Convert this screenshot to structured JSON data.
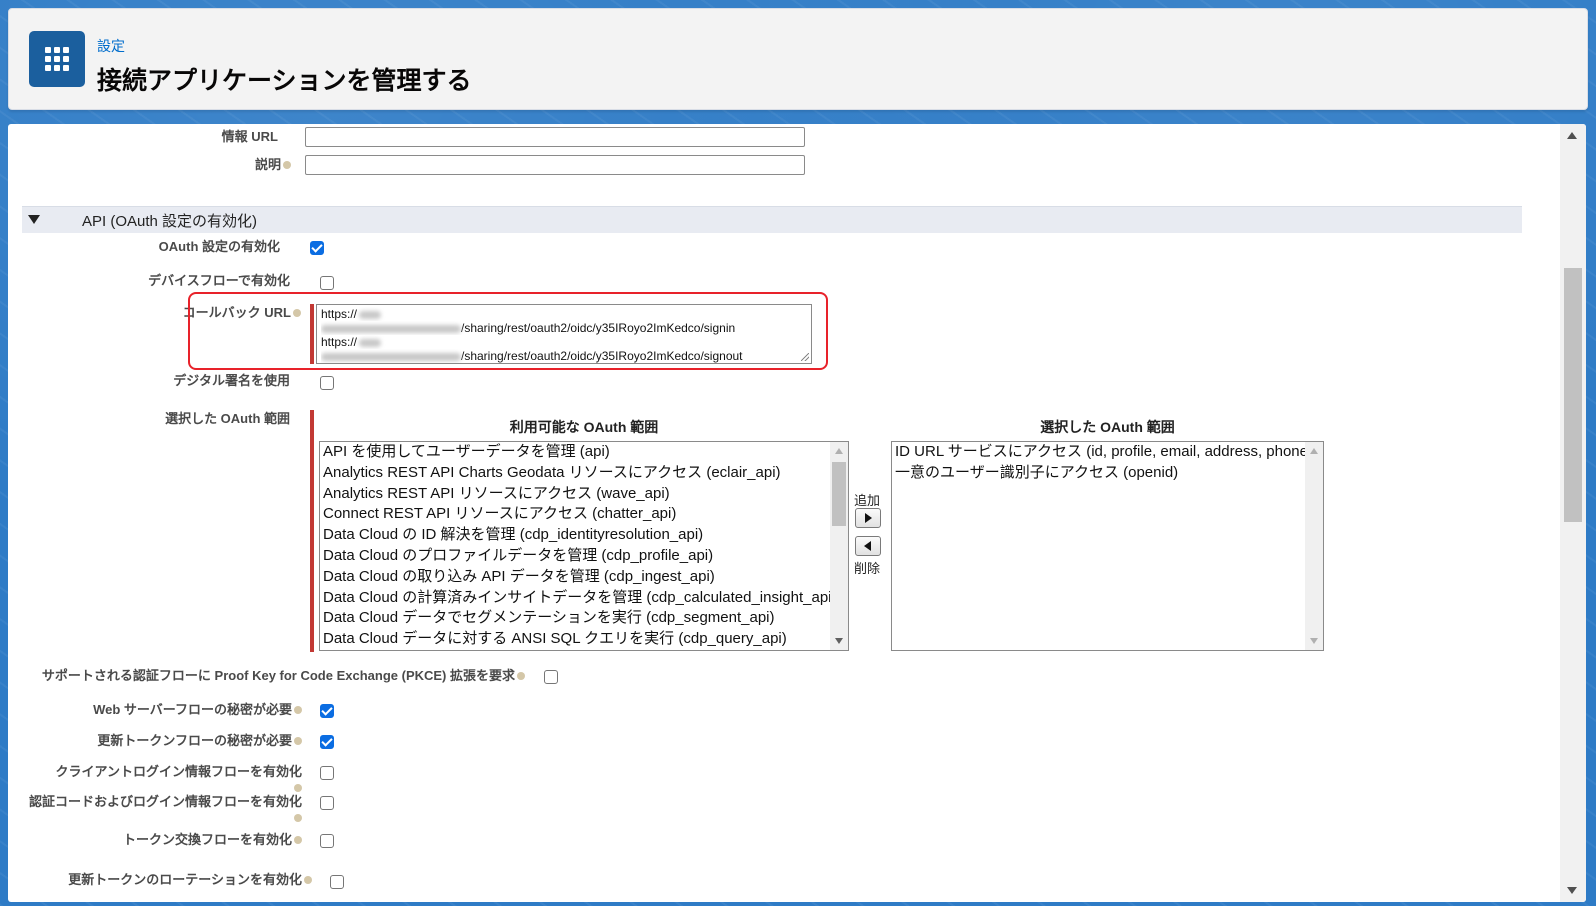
{
  "header": {
    "breadcrumb": "設定",
    "title": "接続アプリケーションを管理する",
    "icon": "app-launcher-grid-icon"
  },
  "fields": {
    "info_url_label": "情報 URL",
    "info_url_value": "",
    "description_label": "説明",
    "description_value": ""
  },
  "section": {
    "title": "API (OAuth 設定の有効化)"
  },
  "oauth": {
    "enable_label": "OAuth 設定の有効化",
    "enable_checked": true,
    "device_flow_label": "デバイスフローで有効化",
    "device_flow_checked": false,
    "callback_label": "コールバック URL",
    "callback_lines": [
      "https://",
      "/sharing/rest/oauth2/oidc/y35IRoyo2ImKedco/signin",
      "https://",
      "/sharing/rest/oauth2/oidc/y35IRoyo2ImKedco/signout"
    ],
    "digital_sig_label": "デジタル署名を使用",
    "digital_sig_checked": false,
    "scopes_label": "選択した OAuth 範囲",
    "available_header": "利用可能な OAuth 範囲",
    "selected_header": "選択した OAuth 範囲",
    "add_label": "追加",
    "remove_label": "削除",
    "available_scopes": [
      "API を使用してユーザーデータを管理 (api)",
      "Analytics REST API Charts Geodata リソースにアクセス (eclair_api)",
      "Analytics REST API リソースにアクセス (wave_api)",
      "Connect REST API リソースにアクセス (chatter_api)",
      "Data Cloud の ID 解決を管理 (cdp_identityresolution_api)",
      "Data Cloud のプロファイルデータを管理 (cdp_profile_api)",
      "Data Cloud の取り込み API データを管理 (cdp_ingest_api)",
      "Data Cloud の計算済みインサイトデータを管理 (cdp_calculated_insight_api)",
      "Data Cloud データでセグメンテーションを実行 (cdp_segment_api)",
      "Data Cloud データに対する ANSI SQL クエリを実行 (cdp_query_api)"
    ],
    "selected_scopes": [
      "ID URL サービスにアクセス (id, profile, email, address, phone)",
      "一意のユーザー識別子にアクセス (openid)"
    ]
  },
  "options": [
    {
      "label": "サポートされる認証フローに Proof Key for Code Exchange (PKCE) 拡張を要求",
      "checked": false
    },
    {
      "label": "Web サーバーフローの秘密が必要",
      "checked": true
    },
    {
      "label": "更新トークンフローの秘密が必要",
      "checked": true
    },
    {
      "label": "クライアントログイン情報フローを有効化",
      "checked": false
    },
    {
      "label": "認証コードおよびログイン情報フローを有効化",
      "checked": false
    },
    {
      "label": "トークン交換フローを有効化",
      "checked": false
    },
    {
      "label": "更新トークンのローテーションを有効化",
      "checked": false
    }
  ],
  "colors": {
    "highlight": "#e8222a",
    "required_bar": "#c23934",
    "checkbox_checked": "#0b6de2"
  }
}
